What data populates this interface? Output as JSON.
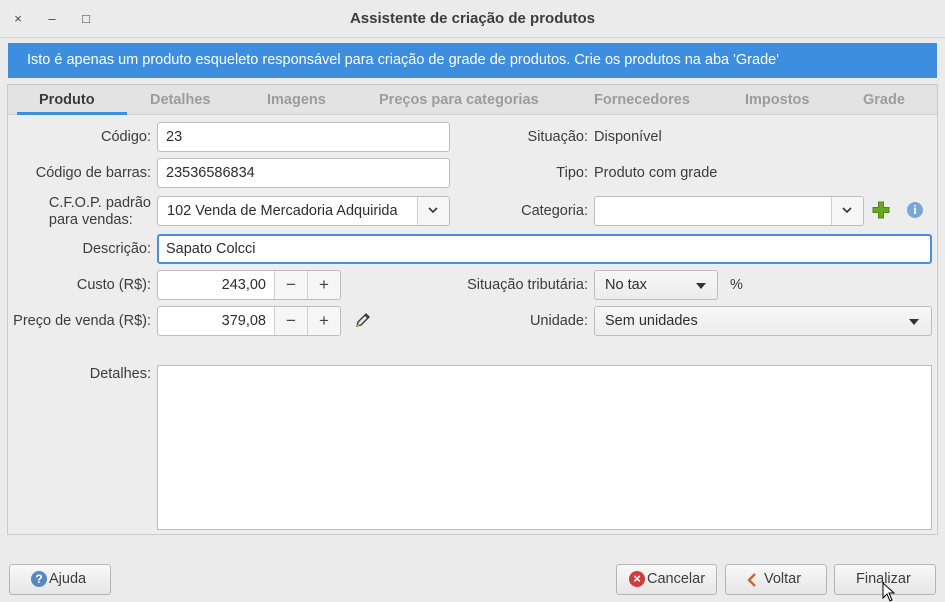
{
  "window": {
    "title": "Assistente de criação de produtos",
    "close_glyph": "×",
    "minimize_glyph": "–",
    "maximize_glyph": "□"
  },
  "banner": "Isto é apenas um produto esqueleto responsável para criação de grade de produtos. Crie os produtos na aba 'Grade'",
  "tabs": [
    {
      "label": "Produto",
      "active": true
    },
    {
      "label": "Detalhes"
    },
    {
      "label": "Imagens"
    },
    {
      "label": "Preços para categorias"
    },
    {
      "label": "Fornecedores"
    },
    {
      "label": "Impostos"
    },
    {
      "label": "Grade"
    }
  ],
  "form": {
    "codigo_label": "Código:",
    "codigo_value": "23",
    "barras_label": "Código de barras:",
    "barras_value": "23536586834",
    "cfop_label_line1": "C.F.O.P. padrão",
    "cfop_label_line2": "para vendas:",
    "cfop_value": "102 Venda de Mercadoria Adquirida",
    "descricao_label": "Descrição:",
    "descricao_value": "Sapato Colcci",
    "custo_label": "Custo (R$):",
    "custo_value": "243,00",
    "preco_label": "Preço de venda (R$):",
    "preco_value": "379,08",
    "minus_glyph": "−",
    "plus_glyph": "+",
    "detalhes_label": "Detalhes:",
    "situacao_label": "Situação:",
    "situacao_value": "Disponível",
    "tipo_label": "Tipo:",
    "tipo_value": "Produto com grade",
    "categoria_label": "Categoria:",
    "categoria_value": "",
    "situacao_trib_label": "Situação tributária:",
    "situacao_trib_value": "No tax",
    "percent": "%",
    "unidade_label": "Unidade:",
    "unidade_value": "Sem unidades"
  },
  "footer": {
    "ajuda": "Ajuda",
    "cancelar": "Cancelar",
    "voltar": "Voltar",
    "finalizar": "Finalizar"
  },
  "colors": {
    "accent": "#3d8ede",
    "add_green": "#6aa820",
    "cancel_red": "#d23b3b",
    "info_blue": "#7aa7d8"
  }
}
